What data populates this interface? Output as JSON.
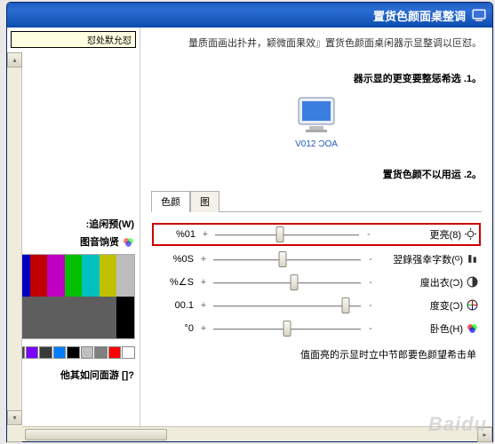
{
  "titlebar": {
    "title": "置货色颜面桌整调"
  },
  "intro": "。量质面画出扑井，颖微面果效』置货色颜面桌闲器示显整调以叵怼",
  "section1_title": "。器示显的更变要整惩希选 .1",
  "monitor_label": "V012 ƆOA",
  "section2_title": "。置货色颜不以用运 .2",
  "tabs": {
    "tab1": "色颜",
    "tab2": "图"
  },
  "sliders": {
    "brightness": {
      "label": "(8)更亮",
      "value": "%01",
      "pos": 45
    },
    "digital": {
      "label": "(ᴳ)翌錄强幸字数",
      "value": "%0S",
      "pos": 47
    },
    "contrast": {
      "label": "(Ɔ)廋出衣",
      "value": "%∠S",
      "pos": 55
    },
    "hue": {
      "label": "(Ɔ)度变",
      "value": "00.1",
      "pos": 90
    },
    "gamma": {
      "label": "(H)卧色",
      "value": "°0",
      "pos": 50
    },
    "footer": "值面亮的示显时立中节郎要色颜望希击单"
  },
  "tooltip": "怼处默允怼",
  "preview_label": "(W)追闲预:",
  "preview_icon_label": "图音饷贤",
  "question": "?[] 他其如问面游",
  "colors": {
    "block": [
      "#bcbcbc",
      "#c0c000",
      "#00c0c0",
      "#00c000",
      "#c000c0",
      "#c00000",
      "#0000c0",
      "#000000",
      "#5e5e5e",
      "#5e5e5e",
      "#5e5e5e",
      "#5e5e5e",
      "#5e5e5e",
      "#5e5e5e"
    ],
    "swatches": [
      "#ffffff",
      "#ff0000",
      "#808080",
      "#bfbfbf",
      "#000000",
      "#007eff",
      "#3a3a3a",
      "#7a00ff",
      "#4a4a4a"
    ]
  }
}
